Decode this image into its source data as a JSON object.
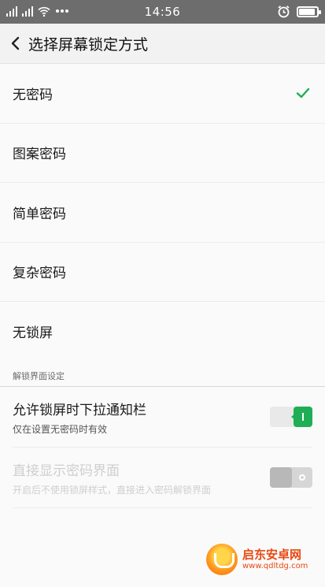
{
  "status_bar": {
    "time": "14:56",
    "icons": [
      "signal-icon",
      "signal-icon",
      "wifi-icon",
      "more-dots-icon",
      "alarm-icon",
      "battery-icon"
    ],
    "battery_level": 0.9
  },
  "header": {
    "title": "选择屏幕锁定方式"
  },
  "lock_options": [
    {
      "label": "无密码",
      "selected": true
    },
    {
      "label": "图案密码",
      "selected": false
    },
    {
      "label": "简单密码",
      "selected": false
    },
    {
      "label": "复杂密码",
      "selected": false
    },
    {
      "label": "无锁屏",
      "selected": false
    }
  ],
  "section": {
    "title": "解锁界面设定"
  },
  "settings": [
    {
      "title": "允许锁屏时下拉通知栏",
      "subtitle": "仅在设置无密码时有效",
      "enabled": true,
      "toggle_on": true
    },
    {
      "title": "直接显示密码界面",
      "subtitle": "开启后不使用锁屏样式，直接进入密码解锁界面",
      "enabled": false,
      "toggle_on": false
    }
  ],
  "watermark": {
    "name": "启东安卓网",
    "url": "www.qdltdg.com"
  },
  "colors": {
    "accent": "#1fae55",
    "status_bar": "#6d6d6d",
    "header": "#f2f2f2"
  }
}
